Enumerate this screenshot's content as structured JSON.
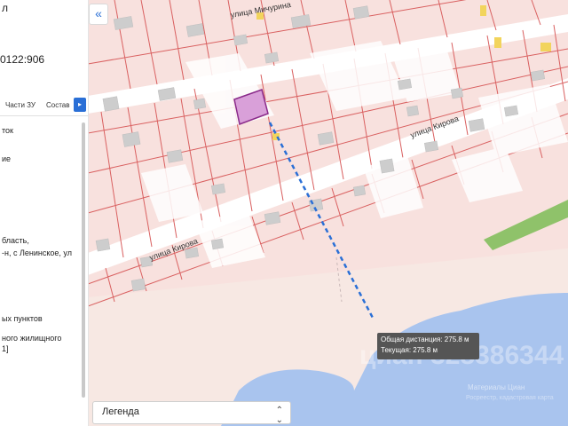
{
  "panel": {
    "header_fragment": "л",
    "cadastral_fragment": "0122:906",
    "tabs": [
      "Части ЗУ",
      "Состав"
    ],
    "lines": [
      "ток",
      "ие",
      "бласть,",
      "-н, с Ленинское, ул",
      "ых пунктов",
      "ного жилищного",
      "1]"
    ]
  },
  "map": {
    "streets": {
      "michurina": "улица Мичурина",
      "kirova_upper": "улица Кирова",
      "kirova_lower": "улица Кирова"
    },
    "tooltip": {
      "total": "Общая дистанция: 275.8 м",
      "current": "Текущая: 275.8 м"
    },
    "watermark": "циан 328386344",
    "credit_line1": "Материалы Циан",
    "credit_line2": "Росреестр, кадастровая карта"
  },
  "legend": {
    "label": "Легенда"
  },
  "colors": {
    "parcel_fill": "#f8e1de",
    "parcel_stroke": "#d96060",
    "building_fill": "#cdcdcd",
    "water": "#a9c4ee",
    "green": "#8fc26a",
    "highlight": "#d9a0d9",
    "measure_line": "#2a6fd6"
  }
}
